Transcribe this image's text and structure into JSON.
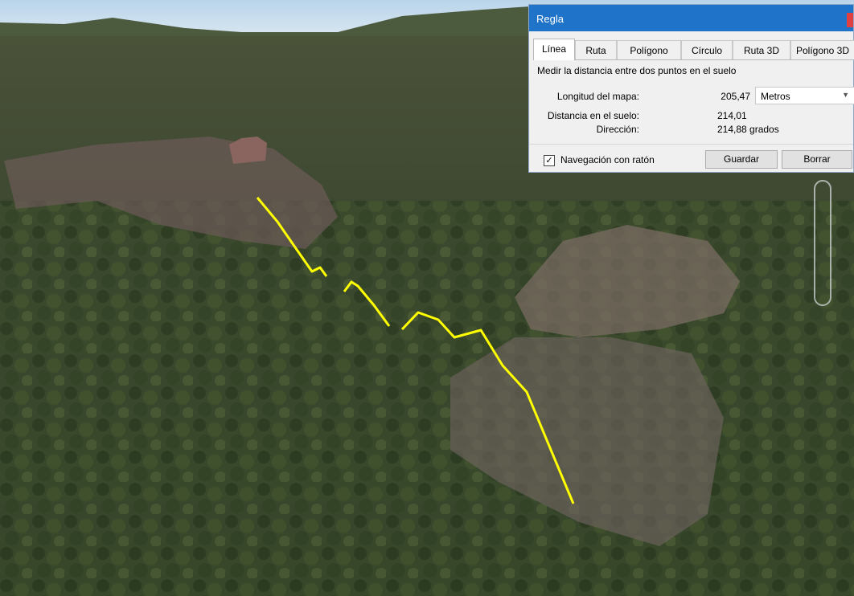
{
  "dialog": {
    "title": "Regla",
    "tabs": [
      "Línea",
      "Ruta",
      "Polígono",
      "Círculo",
      "Ruta 3D",
      "Polígono 3D"
    ],
    "active_tab": "Línea",
    "description": "Medir la distancia entre dos puntos en el suelo",
    "map_length_label": "Longitud del mapa:",
    "map_length_value": "205,47",
    "units_selected": "Metros",
    "ground_distance_label": "Distancia en el suelo:",
    "ground_distance_value": "214,01",
    "heading_label": "Dirección:",
    "heading_value": "214,88 grados",
    "mouse_nav_label": "Navegación con ratón",
    "mouse_nav_checked": true,
    "save_label": "Guardar",
    "clear_label": "Borrar"
  },
  "map": {
    "path_color": "#ffff00"
  }
}
